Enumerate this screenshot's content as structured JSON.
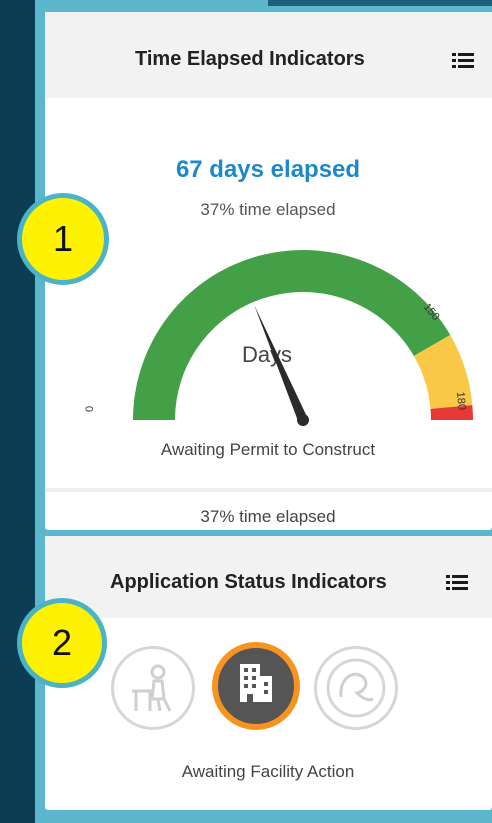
{
  "time_panel": {
    "title": "Time Elapsed Indicators",
    "days_elapsed": "67 days elapsed",
    "percent_elapsed": "37% time elapsed",
    "gauge_center_label": "Days",
    "gauge_tick_min": "0",
    "gauge_tick_mid": "150",
    "gauge_tick_max": "180",
    "gauge_value": 67,
    "gauge_min": 0,
    "gauge_max": 180,
    "gauge_bands": [
      {
        "from": 0,
        "to": 150,
        "color": "#43a047"
      },
      {
        "from": 150,
        "to": 175,
        "color": "#f9c846"
      },
      {
        "from": 175,
        "to": 180,
        "color": "#e53935"
      }
    ],
    "stage_label": "Awaiting Permit to Construct",
    "footer_percent": "37% time elapsed"
  },
  "status_panel": {
    "title": "Application Status Indicators",
    "icons": [
      {
        "name": "desk-worker-icon",
        "state": "inactive"
      },
      {
        "name": "building-icon",
        "state": "active"
      },
      {
        "name": "atlas-document-icon",
        "state": "inactive"
      }
    ],
    "status_label": "Awaiting Facility Action"
  },
  "callouts": {
    "one": "1",
    "two": "2"
  },
  "colors": {
    "days_text": "#1e88c9",
    "active_icon_ring": "#f7931e",
    "active_icon_fill": "#555555",
    "inactive_icon": "#d0d0d0"
  }
}
